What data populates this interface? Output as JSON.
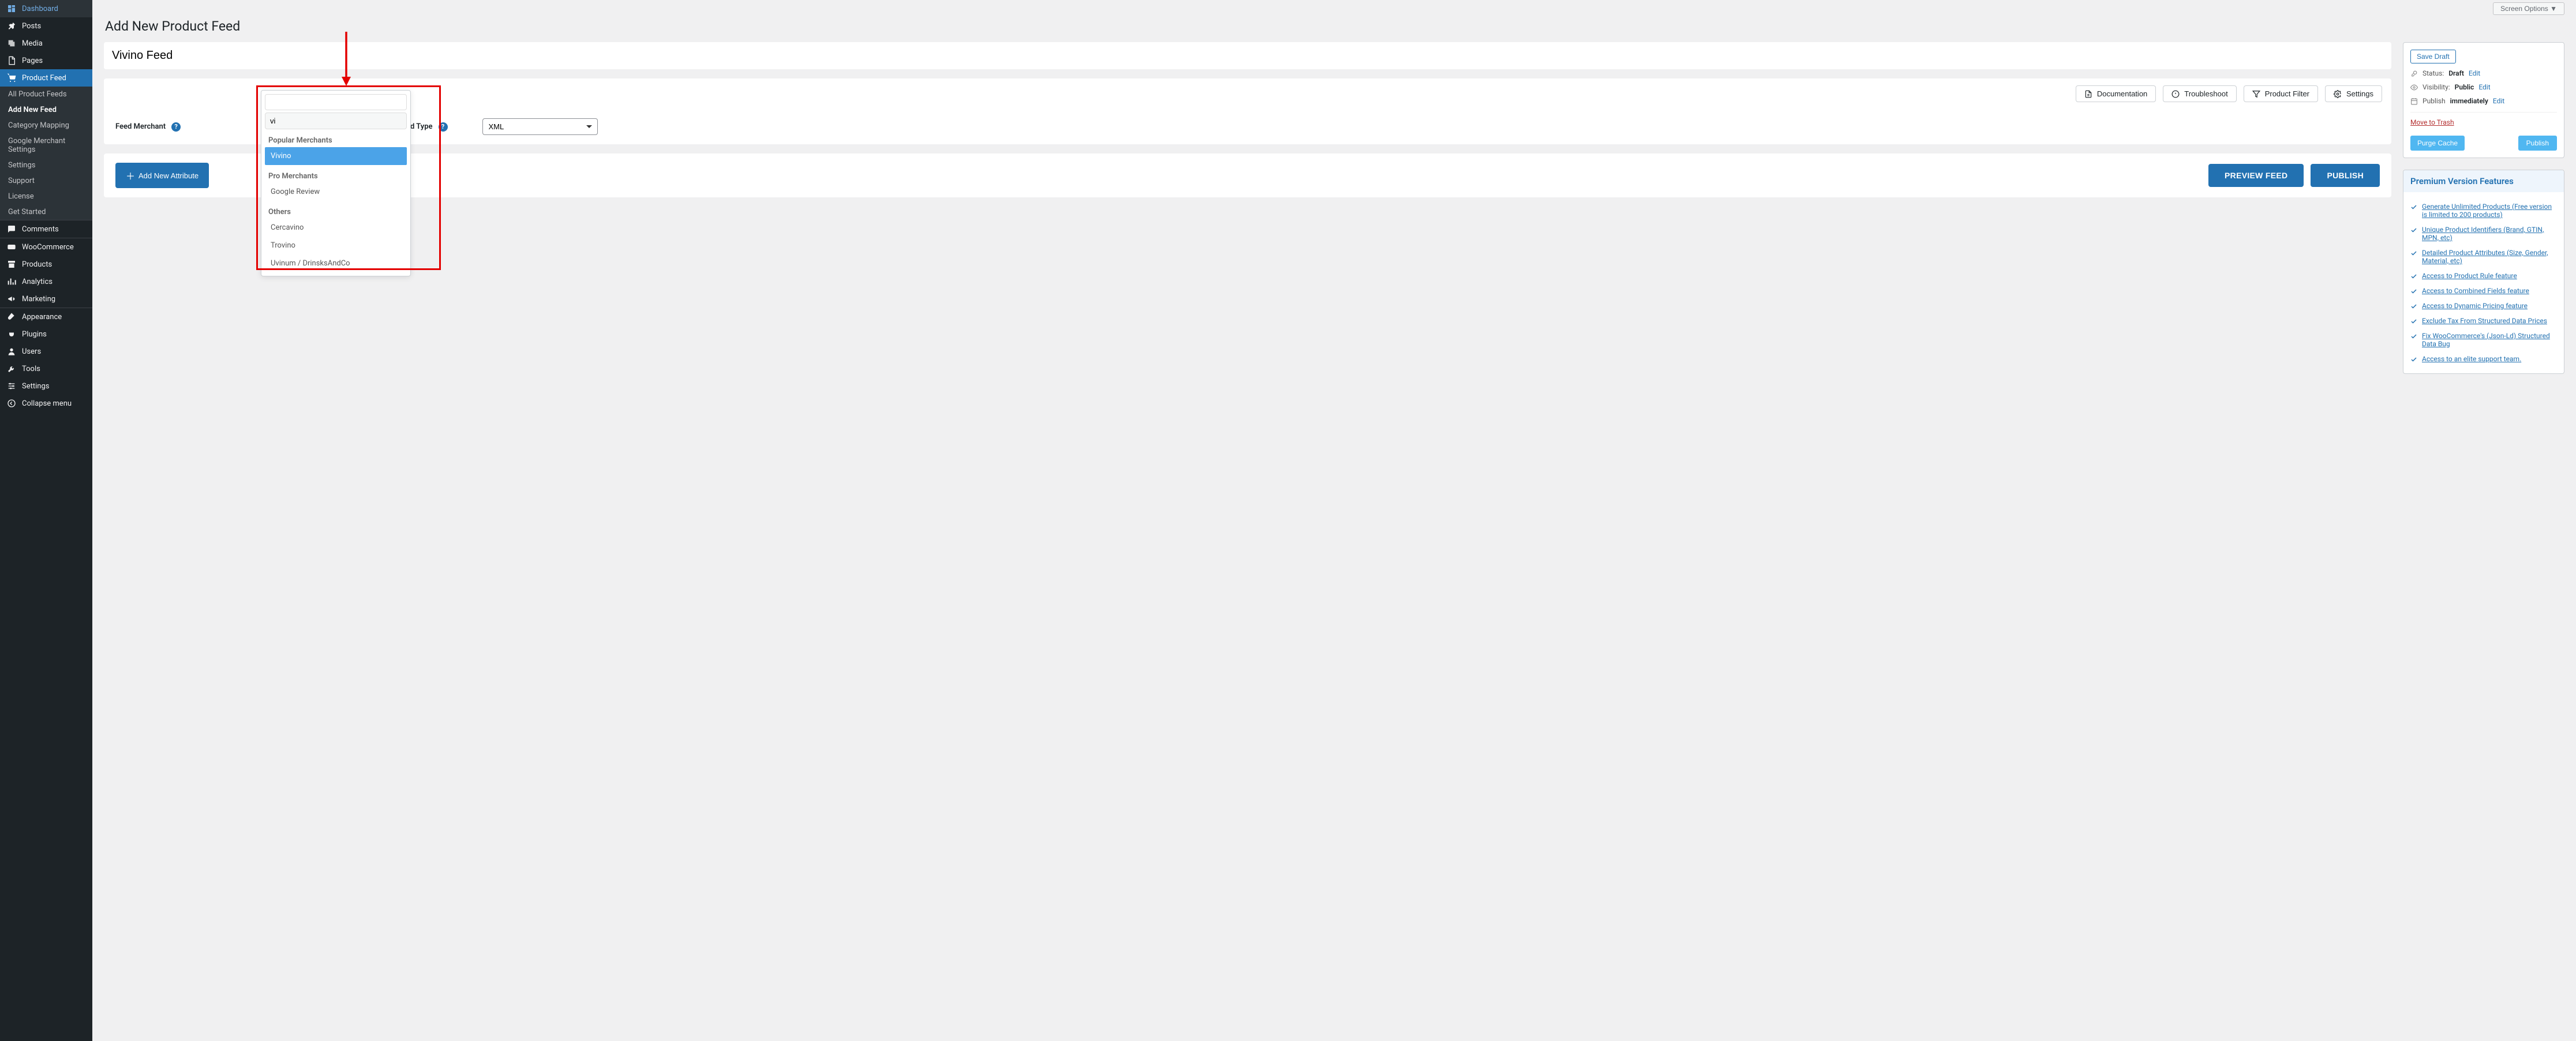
{
  "sidebar": {
    "items": [
      {
        "label": "Dashboard",
        "icon": "dashboard"
      },
      {
        "label": "Posts",
        "icon": "pin"
      },
      {
        "label": "Media",
        "icon": "media"
      },
      {
        "label": "Pages",
        "icon": "page"
      },
      {
        "label": "Product Feed",
        "icon": "cart",
        "active": true
      },
      {
        "label": "Comments",
        "icon": "comment"
      },
      {
        "label": "WooCommerce",
        "icon": "woo"
      },
      {
        "label": "Products",
        "icon": "archive"
      },
      {
        "label": "Analytics",
        "icon": "bars"
      },
      {
        "label": "Marketing",
        "icon": "megaphone"
      },
      {
        "label": "Appearance",
        "icon": "brush"
      },
      {
        "label": "Plugins",
        "icon": "plug"
      },
      {
        "label": "Users",
        "icon": "user"
      },
      {
        "label": "Tools",
        "icon": "wrench"
      },
      {
        "label": "Settings",
        "icon": "sliders"
      },
      {
        "label": "Collapse menu",
        "icon": "collapse"
      }
    ],
    "sub": [
      "All Product Feeds",
      "Add New Feed",
      "Category Mapping",
      "Google Merchant Settings",
      "Settings",
      "Support",
      "License",
      "Get Started"
    ],
    "sub_current": "Add New Feed"
  },
  "top": {
    "screen_options": "Screen Options ▼"
  },
  "page": {
    "heading": "Add New Product Feed",
    "title_value": "Vivino Feed"
  },
  "actions": {
    "documentation": "Documentation",
    "troubleshoot": "Troubleshoot",
    "product_filter": "Product Filter",
    "settings": "Settings"
  },
  "form": {
    "merchant_label": "Feed Merchant",
    "type_label": "Feed Type",
    "type_value": "XML",
    "add_attribute": "Add New Attribute",
    "preview": "PREVIEW FEED",
    "publish": "PUBLISH"
  },
  "dropdown": {
    "search_value": "vi",
    "groups": [
      {
        "title": "Popular Merchants",
        "items": [
          {
            "label": "Vivino",
            "highlighted": true
          }
        ]
      },
      {
        "title": "Pro Merchants",
        "items": [
          {
            "label": "Google Review"
          }
        ]
      },
      {
        "title": "Others",
        "items": [
          {
            "label": "Cercavino"
          },
          {
            "label": "Trovino"
          },
          {
            "label": "Uvinum / DrinsksAndCo"
          }
        ]
      }
    ]
  },
  "publish_box": {
    "save_draft": "Save Draft",
    "status_label": "Status:",
    "status_value": "Draft",
    "visibility_label": "Visibility:",
    "visibility_value": "Public",
    "publish_label": "Publish",
    "publish_value": "immediately",
    "edit": "Edit",
    "trash": "Move to Trash",
    "purge": "Purge Cache",
    "publish_btn": "Publish"
  },
  "premium": {
    "heading": "Premium Version Features",
    "features": [
      "Generate Unlimited Products (Free version is limited to 200 products)",
      "Unique Product Identifiers (Brand, GTIN, MPN, etc)",
      "Detailed Product Attributes (Size, Gender, Material, etc)",
      "Access to Product Rule feature",
      "Access to Combined Fields feature",
      "Access to Dynamic Pricing feature",
      "Exclude Tax From Structured Data Prices",
      "Fix WooCommerce's (Json-Ld) Structured Data Bug",
      "Access to an elite support team."
    ]
  }
}
